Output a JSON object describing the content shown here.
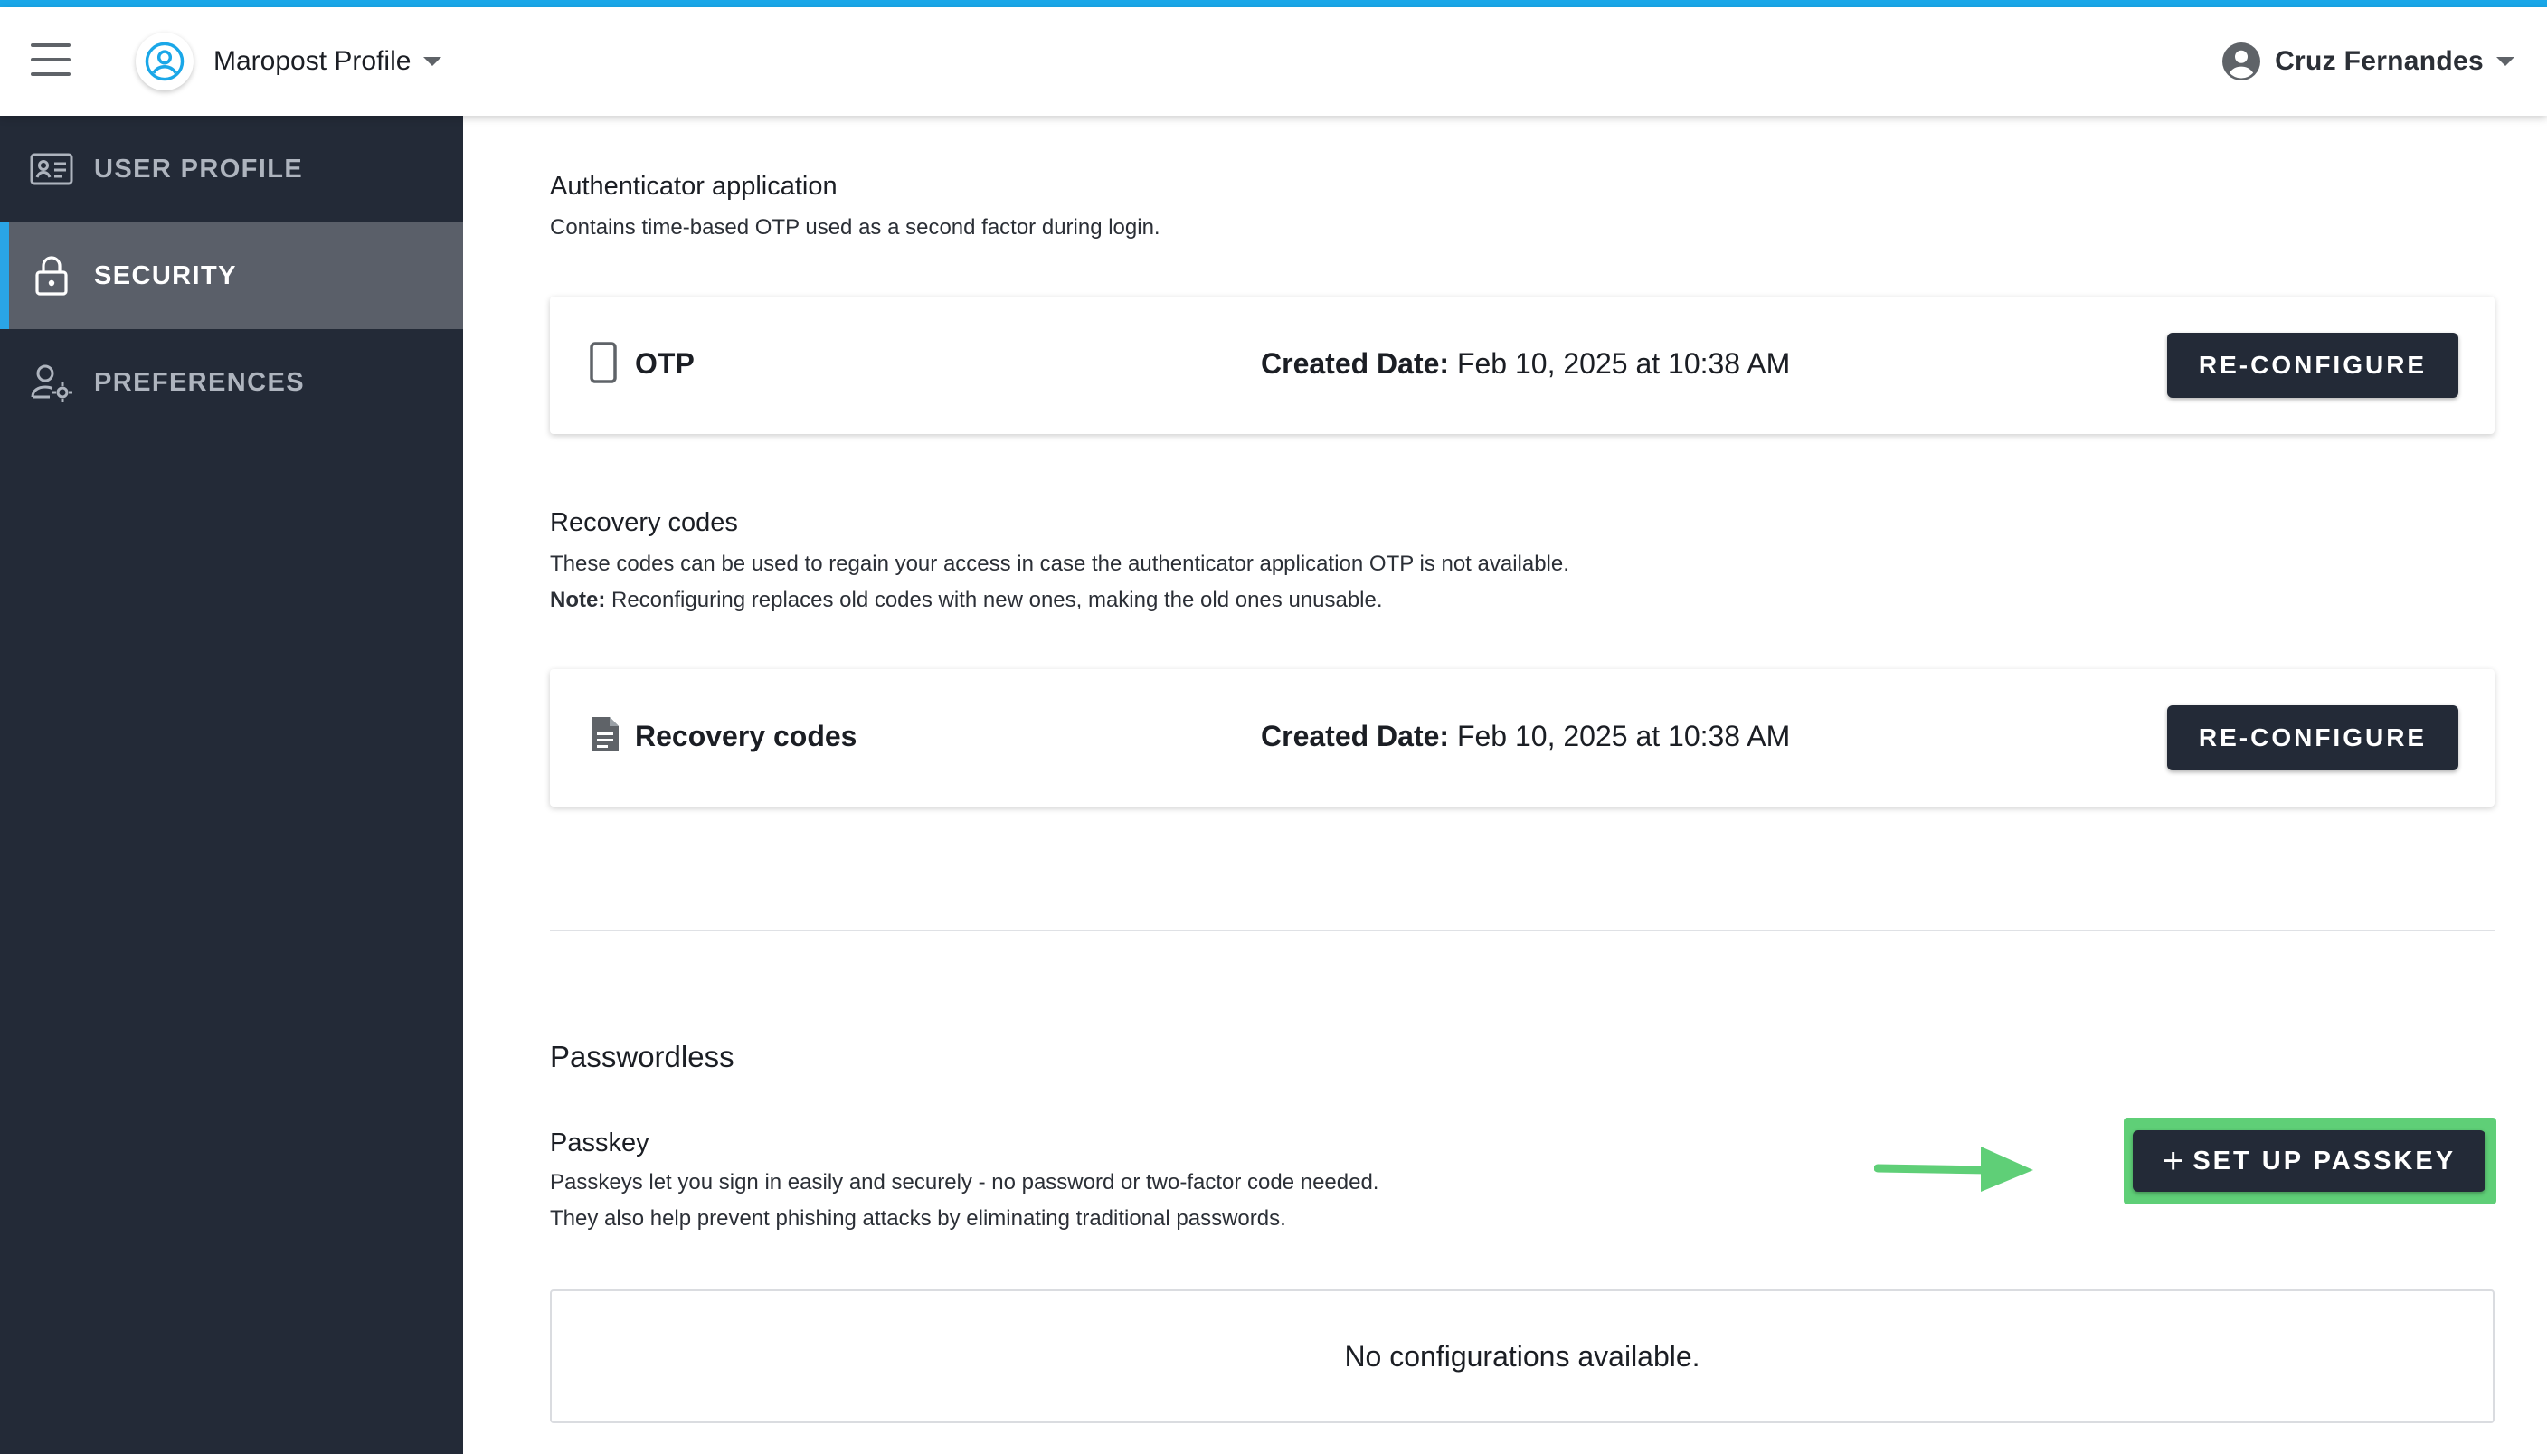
{
  "header": {
    "profile_name": "Maropost Profile",
    "user_name": "Cruz Fernandes"
  },
  "sidebar": {
    "items": [
      {
        "label": "USER PROFILE",
        "icon": "id-card-icon",
        "active": false
      },
      {
        "label": "SECURITY",
        "icon": "lock-icon",
        "active": true
      },
      {
        "label": "PREFERENCES",
        "icon": "user-settings-icon",
        "active": false
      }
    ]
  },
  "authenticator": {
    "title": "Authenticator application",
    "description": "Contains time-based OTP used as a second factor during login.",
    "card": {
      "name": "OTP",
      "icon": "phone-icon",
      "created_label": "Created Date:",
      "created_value": "Feb 10, 2025 at 10:38 AM",
      "button_label": "RE-CONFIGURE"
    }
  },
  "recovery": {
    "title": "Recovery codes",
    "description": "These codes can be used to regain your access in case the authenticator application OTP is not available.",
    "note_label": "Note:",
    "note_text": "Reconfiguring replaces old codes with new ones, making the old ones unusable.",
    "card": {
      "name": "Recovery codes",
      "icon": "document-icon",
      "created_label": "Created Date:",
      "created_value": "Feb 10, 2025 at 10:38 AM",
      "button_label": "RE-CONFIGURE"
    }
  },
  "passwordless": {
    "title": "Passwordless",
    "passkey_title": "Passkey",
    "passkey_desc_line1": "Passkeys let you sign in easily and securely - no password or two-factor code needed.",
    "passkey_desc_line2": "They also help prevent phishing attacks by eliminating traditional passwords.",
    "setup_button_label": "SET UP PASSKEY",
    "setup_button_icon": "plus-icon",
    "empty_text": "No configurations available."
  },
  "colors": {
    "accent": "#1aa7e8",
    "sidebar_bg": "#232a37",
    "sidebar_active": "#5a5f69",
    "button_dark": "#232a37",
    "highlight_green": "#5fcf77"
  }
}
